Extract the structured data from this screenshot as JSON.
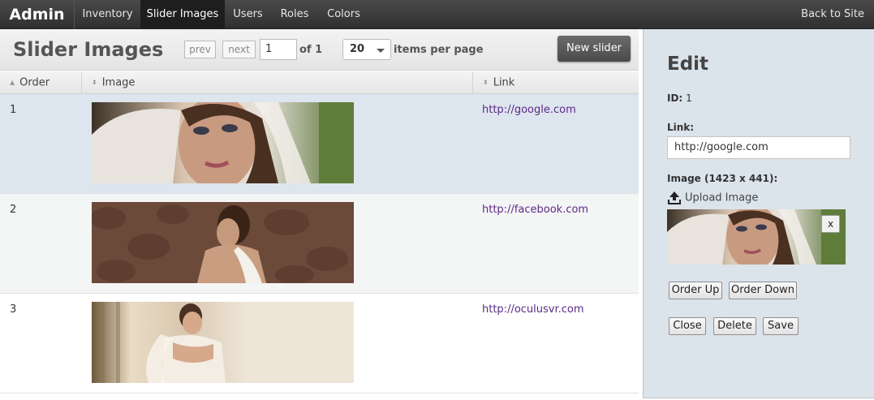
{
  "nav": {
    "brand": "Admin",
    "items": [
      {
        "label": "Inventory"
      },
      {
        "label": "Slider Images"
      },
      {
        "label": "Users"
      },
      {
        "label": "Roles"
      },
      {
        "label": "Colors"
      }
    ],
    "active": "Slider Images",
    "back_label": "Back to Site"
  },
  "list": {
    "title": "Slider Images",
    "prev_label": "prev",
    "next_label": "next",
    "page_value": "1",
    "of_text": "of 1",
    "per_page_value": "20",
    "per_page_text": "items per page",
    "new_button": "New slider"
  },
  "table": {
    "columns": [
      "Order",
      "Image",
      "Link"
    ],
    "rows": [
      {
        "order": "1",
        "link": "http://google.com",
        "image_icon": "bride-veil-closeup-image"
      },
      {
        "order": "2",
        "link": "http://facebook.com",
        "image_icon": "bride-back-stone-wall-image"
      },
      {
        "order": "3",
        "link": "http://oculusvr.com",
        "image_icon": "bride-window-light-image"
      }
    ],
    "selected_row": "1"
  },
  "edit": {
    "title": "Edit",
    "id_label": "ID:",
    "id_value": "1",
    "link_label": "Link:",
    "link_value": "http://google.com",
    "image_label": "Image (1423 x 441):",
    "upload_label": "Upload Image",
    "remove_label": "x",
    "order_up": "Order Up",
    "order_down": "Order Down",
    "close": "Close",
    "delete": "Delete",
    "save": "Save"
  },
  "colors": {
    "topbar": "#3a3a3a",
    "active_nav": "#1e1e1e",
    "selected_row": "#dde5ee",
    "edit_panel": "#dbe3eb",
    "link": "#5b2a86"
  }
}
